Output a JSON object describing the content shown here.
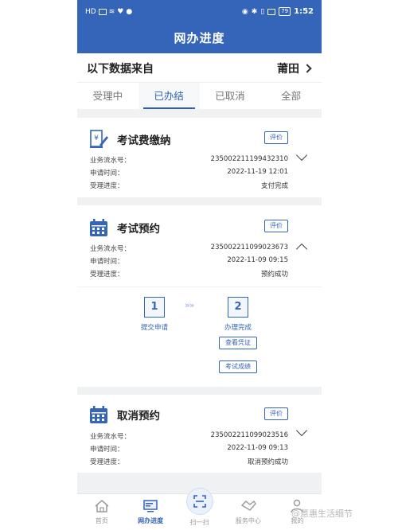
{
  "status_bar": {
    "left": "HD",
    "battery": "79",
    "time": "1:52"
  },
  "header": {
    "title": "网办进度"
  },
  "source": {
    "label": "以下数据来自",
    "city": "莆田"
  },
  "tabs": [
    {
      "label": "受理中"
    },
    {
      "label": "已办结"
    },
    {
      "label": "已取消"
    },
    {
      "label": "全部"
    }
  ],
  "labels": {
    "serial": "业务流水号：",
    "apply_time": "申请时间：",
    "progress": "受理进度："
  },
  "records": [
    {
      "title": "考试费缴纳",
      "eval": "评价",
      "serial": "235002211199432310",
      "apply_time": "2022-11-19 12:01",
      "progress": "支付完成",
      "icon": "receipt-icon",
      "expanded": false
    },
    {
      "title": "考试预约",
      "eval": "评价",
      "serial": "235002211099023673",
      "apply_time": "2022-11-09 09:15",
      "progress": "预约成功",
      "icon": "calendar-icon",
      "expanded": true
    },
    {
      "title": "取消预约",
      "eval": "评价",
      "serial": "235002211099023516",
      "apply_time": "2022-11-09 09:13",
      "progress": "取消预约成功",
      "icon": "calendar-icon",
      "expanded": false
    }
  ],
  "progress_steps": [
    {
      "num": "1",
      "label": "提交申请"
    },
    {
      "num": "2",
      "label": "办理完成"
    }
  ],
  "progress_buttons": {
    "view_cert": "查看凭证",
    "exam_score": "考试成绩"
  },
  "nav": [
    {
      "label": "首页",
      "icon": "home-icon"
    },
    {
      "label": "网办进度",
      "icon": "monitor-icon"
    },
    {
      "label": "扫一扫",
      "icon": "scan-icon"
    },
    {
      "label": "服务中心",
      "icon": "handshake-icon"
    },
    {
      "label": "我的",
      "icon": "user-icon"
    }
  ],
  "watermark": "@蒽惠生活细节",
  "colors": {
    "primary": "#3565b8",
    "background": "#f0f1f3"
  }
}
